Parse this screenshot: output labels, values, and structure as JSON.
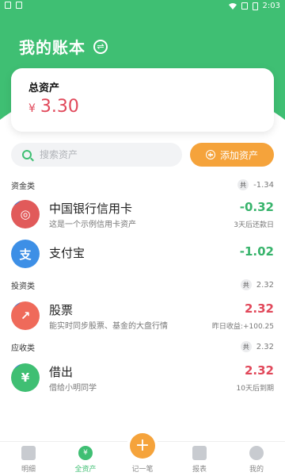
{
  "status_bar": {
    "time": "2:03"
  },
  "header": {
    "title": "我的账本"
  },
  "total": {
    "label": "总资产",
    "currency": "¥",
    "value": "3.30"
  },
  "search": {
    "placeholder": "搜索资产"
  },
  "add_button": {
    "label": "添加资产"
  },
  "sections": [
    {
      "title": "资金类",
      "badge": "共",
      "total": "-1.34",
      "items": [
        {
          "name": "中国银行信用卡",
          "desc": "这是一个示例信用卡资产",
          "value": "-0.32",
          "sub": "3天后还款日",
          "icon_text": "◎",
          "icon_color": "#e15a5a"
        },
        {
          "name": "支付宝",
          "desc": "",
          "value": "-1.02",
          "sub": "",
          "icon_text": "支",
          "icon_color": "#3d8fe6"
        }
      ]
    },
    {
      "title": "投资类",
      "badge": "共",
      "total": "2.32",
      "items": [
        {
          "name": "股票",
          "desc": "能实时同步股票、基金的大盘行情",
          "value": "2.32",
          "sub": "昨日收益:+100.25",
          "icon_text": "↗",
          "icon_color": "#ef6a5a"
        }
      ]
    },
    {
      "title": "应收类",
      "badge": "共",
      "total": "2.32",
      "items": [
        {
          "name": "借出",
          "desc": "借给小明同学",
          "value": "2.32",
          "sub": "10天后到期",
          "icon_text": "¥",
          "icon_color": "#3fbf73"
        }
      ]
    }
  ],
  "bottom_nav": {
    "items": [
      "明细",
      "全资产",
      "记一笔",
      "报表",
      "我的"
    ],
    "record_symbol": "+"
  },
  "colors": {
    "brand_green": "#3fbf73",
    "accent_orange": "#f5a33b",
    "negative_green": "#37b36b",
    "positive_red": "#e1485a"
  }
}
